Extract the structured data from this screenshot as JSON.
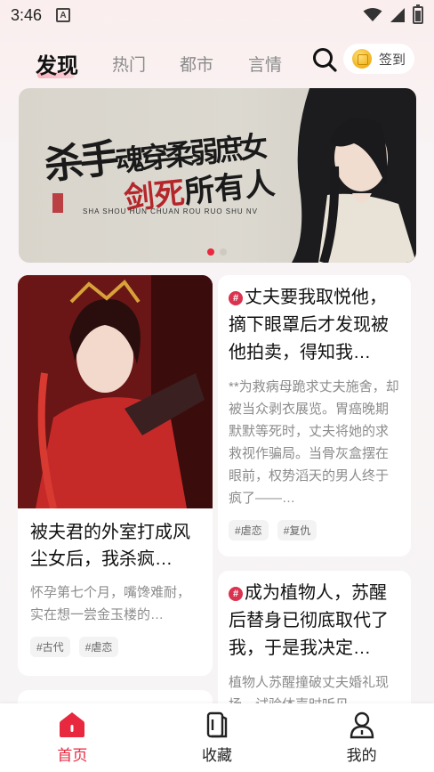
{
  "status_bar": {
    "time": "3:46",
    "notification_icon": "A"
  },
  "top_nav": {
    "tabs": [
      {
        "label": "发现",
        "active": true
      },
      {
        "label": "热门",
        "active": false
      },
      {
        "label": "都市",
        "active": false
      },
      {
        "label": "言情",
        "active": false
      }
    ],
    "checkin_label": "签到",
    "search_icon": "search-icon",
    "coin_icon": "coin-icon"
  },
  "banner": {
    "title_part1": "杀手",
    "title_part2": "魂穿柔弱庶女",
    "title_part3": "剑死",
    "title_part4": "所有人",
    "pinyin": "SHA SHOU   HUN CHUAN ROU RUO SHU NV",
    "dots": 2,
    "active_dot": 0
  },
  "feed": [
    {
      "title": "被夫君的外室打成风尘女后，我杀疯…",
      "desc": "怀孕第七个月，嘴馋难耐，实在想一尝金玉楼的…",
      "tags": [
        "#古代",
        "#虐恋"
      ],
      "has_cover": true
    },
    {
      "badge": "#",
      "title": "丈夫要我取悦他，摘下眼罩后才发现被他拍卖，得知我…",
      "desc": "**为救病母跪求丈夫施舍，却被当众剥衣展览。胃癌晚期默默等死时，丈夫将她的求救视作骗局。当骨灰盒摆在眼前，权势滔天的男人终于疯了——…",
      "tags": [
        "#虐恋",
        "#复仇"
      ]
    },
    {
      "badge": "#",
      "title": "成为植物人，苏醒后替身已彻底取代了我，于是我决定…",
      "desc": "植物人苏醒撞破丈夫婚礼现场，试验体声时听见"
    }
  ],
  "bottom_nav": [
    {
      "label": "首页",
      "icon": "home-icon",
      "active": true
    },
    {
      "label": "收藏",
      "icon": "bookshelf-icon",
      "active": false
    },
    {
      "label": "我的",
      "icon": "profile-icon",
      "active": false
    }
  ],
  "colors": {
    "accent": "#e8283f",
    "text": "#111111",
    "muted": "#8c8c8c"
  }
}
